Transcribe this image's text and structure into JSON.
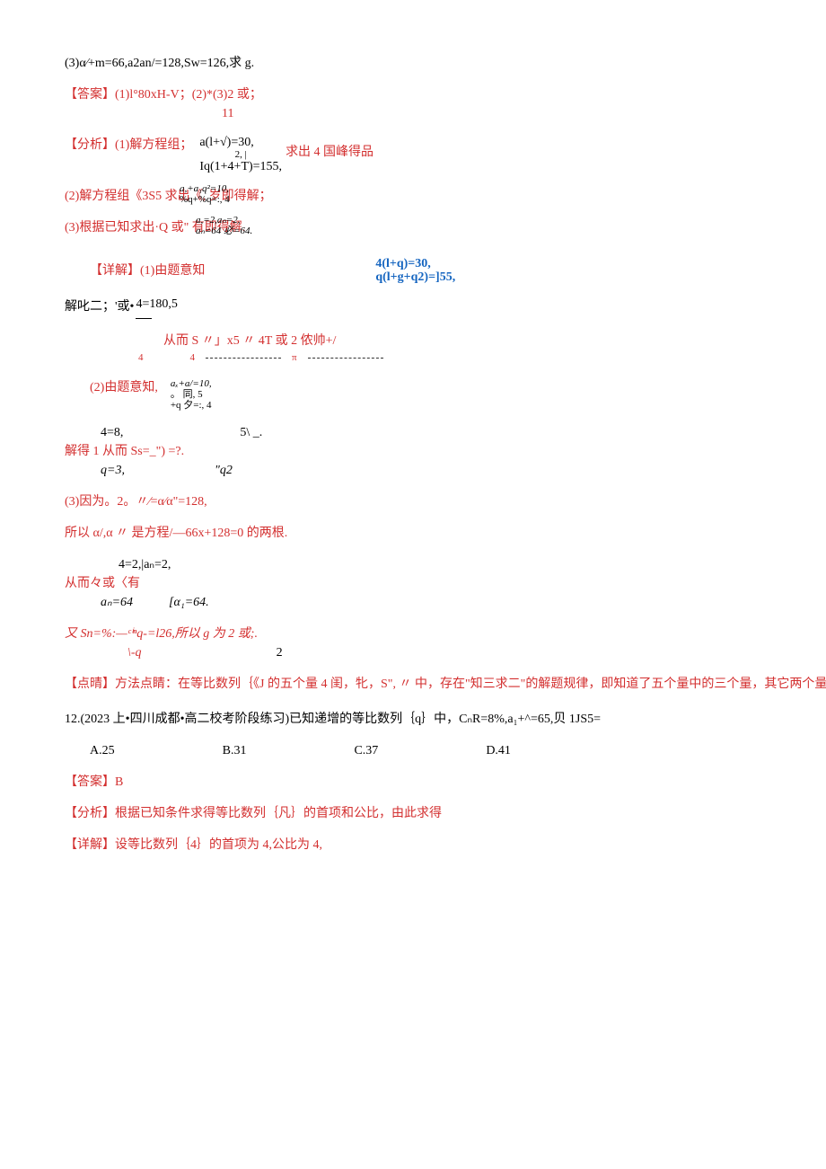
{
  "p3": "(3)α⁄+m=66,a2an/=128,Sw=126,求 g.",
  "ans_ln1": "【答案】(1)l°80xH-V；(2)*(3)2 或；",
  "ans_ln2": "11",
  "fx_lead": "【分析】(1)解方程组；",
  "fx_frac_top": "a(l+√)=30,",
  "fx_frac_mid": "2, |",
  "fx_frac_bot": "Iq(1+4+T)=155,",
  "fx_tail": "求出 4 国峰得品",
  "fx2_lead": "(2)解方程组《3S5 求出《, 岁即得解；",
  "fx2_top": "a,+a₁q²=10,",
  "fx2_bot": "%q+%q=:, 4",
  "fx3_lead": "(3)根据已知求出·Q 或\" 有即得解.",
  "fx3_top": "a,=2,aₙ=2,",
  "fx3_bot": "aₙ=64 必=64.",
  "xj1_lead": "【详解】(1)由题意知",
  "xj1_top": "4(l+q)=30,",
  "xj1_bot": "q(l+g+q2)=]55,",
  "jh_lead": "解叱二；'或•",
  "jh_top": "4=180,5",
  "jh_bot": "一",
  "so_line": "从而 S 〃」x5 〃 4T 或 2 侬帅+/",
  "so_l4a": "4",
  "so_l4b": "4",
  "so_ttl": "π",
  "p2b_lead": "(2)由题意知,",
  "p2b_top": "aₓ+a/=10,",
  "p2b_mid": "。 同, 5",
  "p2b_bot": "+q 夕=:, 4",
  "jd1_top_l": "4=8,",
  "jd1_top_r": "5\\ _.",
  "jd1_mid": "解得 1 从而 Ss=_\") =?.",
  "jd1_bot_l": "q=3,",
  "jd1_bot_r": "\"q2",
  "p3b": "(3)因为。2。〃⁄=α⁄α\"=128,",
  "sy_line": "所以 α/,α 〃 是方程/—66x+128=0 的两根.",
  "ce_top": "4=2,|aₙ=2,",
  "ce_mid": "从而々或〈有",
  "ce_bot_l": "aₙ=64",
  "ce_bot_r": "[α₁=64.",
  "you_top": "又 Sn=%:—ᶜⁱⁿq-=l26,所以 g 为 2 或;.",
  "you_bot_l": "\\-q",
  "you_bot_r": "2",
  "dq1": "【点晴】方法点睛：在等比数列｛《J 的五个量 4 闺，牝，S\", 〃 中，存在\"知三求二\"的解题规律，即知道了五个量中的三个量，其它两个量可求.",
  "q12_stem": "12.(2023 上•四川成都•高二校考阶段练习)已知递增的等比数列｛q｝中，CₙR=8%,a₁+^=65,贝 1JS5=",
  "q12_A": "A.25",
  "q12_B": "B.31",
  "q12_C": "C.37",
  "q12_D": "D.41",
  "ans12": "【答案】B",
  "fx12": "【分析】根据已知条件求得等比数列｛凡｝的首项和公比，由此求得",
  "xj12": "【详解】设等比数列｛4｝的首项为 4,公比为 4,"
}
